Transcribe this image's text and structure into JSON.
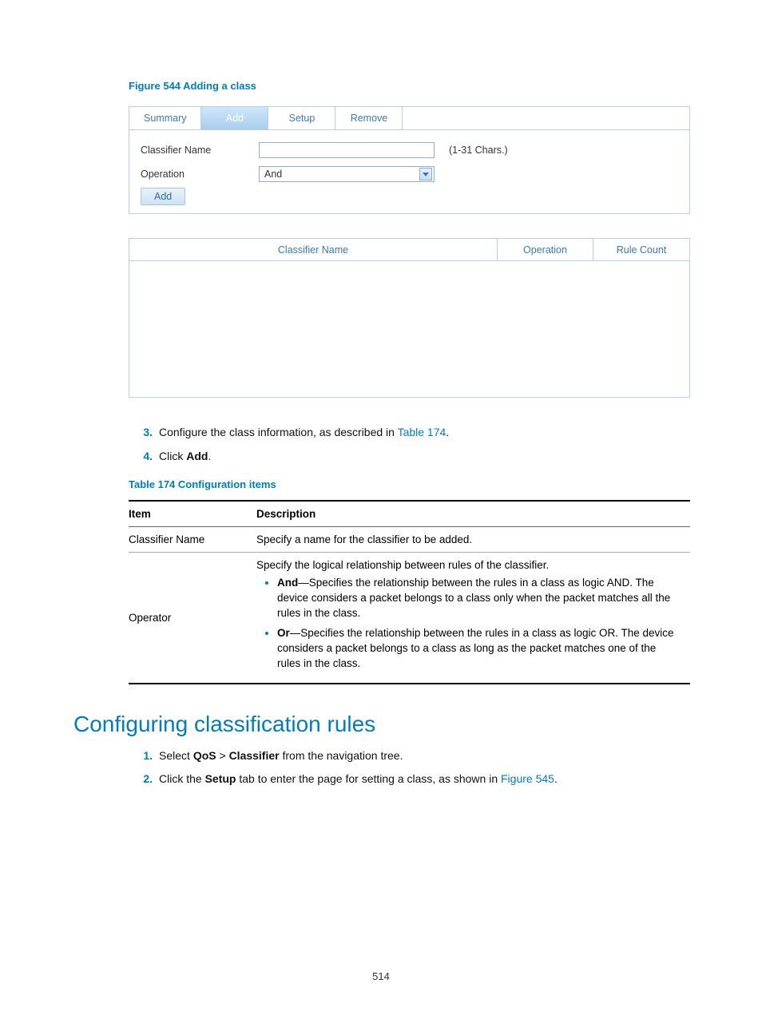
{
  "figure": {
    "caption": "Figure 544 Adding a class",
    "tabs": {
      "summary": "Summary",
      "add": "Add",
      "setup": "Setup",
      "remove": "Remove"
    },
    "form": {
      "classifier_label": "Classifier Name",
      "classifier_value": "",
      "range_hint": "(1-31 Chars.)",
      "operation_label": "Operation",
      "operation_value": "And",
      "add_button": "Add"
    },
    "results_header": {
      "col1": "Classifier Name",
      "col2": "Operation",
      "col3": "Rule Count"
    }
  },
  "steps1": {
    "n3": "3.",
    "t3a": "Configure the class information, as described in ",
    "t3link": "Table 174",
    "t3b": ".",
    "n4": "4.",
    "t4a": "Click ",
    "t4bold": "Add",
    "t4b": "."
  },
  "table174": {
    "caption": "Table 174 Configuration items",
    "head_item": "Item",
    "head_desc": "Description",
    "row1_item": "Classifier Name",
    "row1_desc": "Specify a name for the classifier to be added.",
    "row2_item": "Operator",
    "row2_intro": "Specify the logical relationship between rules of the classifier.",
    "row2_b1_bold": "And",
    "row2_b1_rest": "—Specifies the relationship between the rules in a class as logic AND. The device considers a packet belongs to a class only when the packet matches all the rules in the class.",
    "row2_b2_bold": "Or",
    "row2_b2_rest": "—Specifies the relationship between the rules in a class as logic OR. The device considers a packet belongs to a class as long as the packet matches one of the rules in the class."
  },
  "h2": "Configuring classification rules",
  "steps2": {
    "n1": "1.",
    "t1a": "Select ",
    "t1b1": "QoS",
    "t1sep": " > ",
    "t1b2": "Classifier",
    "t1c": " from the navigation tree.",
    "n2": "2.",
    "t2a": "Click the ",
    "t2bold": "Setup",
    "t2b": " tab to enter the page for setting a class, as shown in ",
    "t2link": "Figure 545",
    "t2c": "."
  },
  "page_number": "514"
}
